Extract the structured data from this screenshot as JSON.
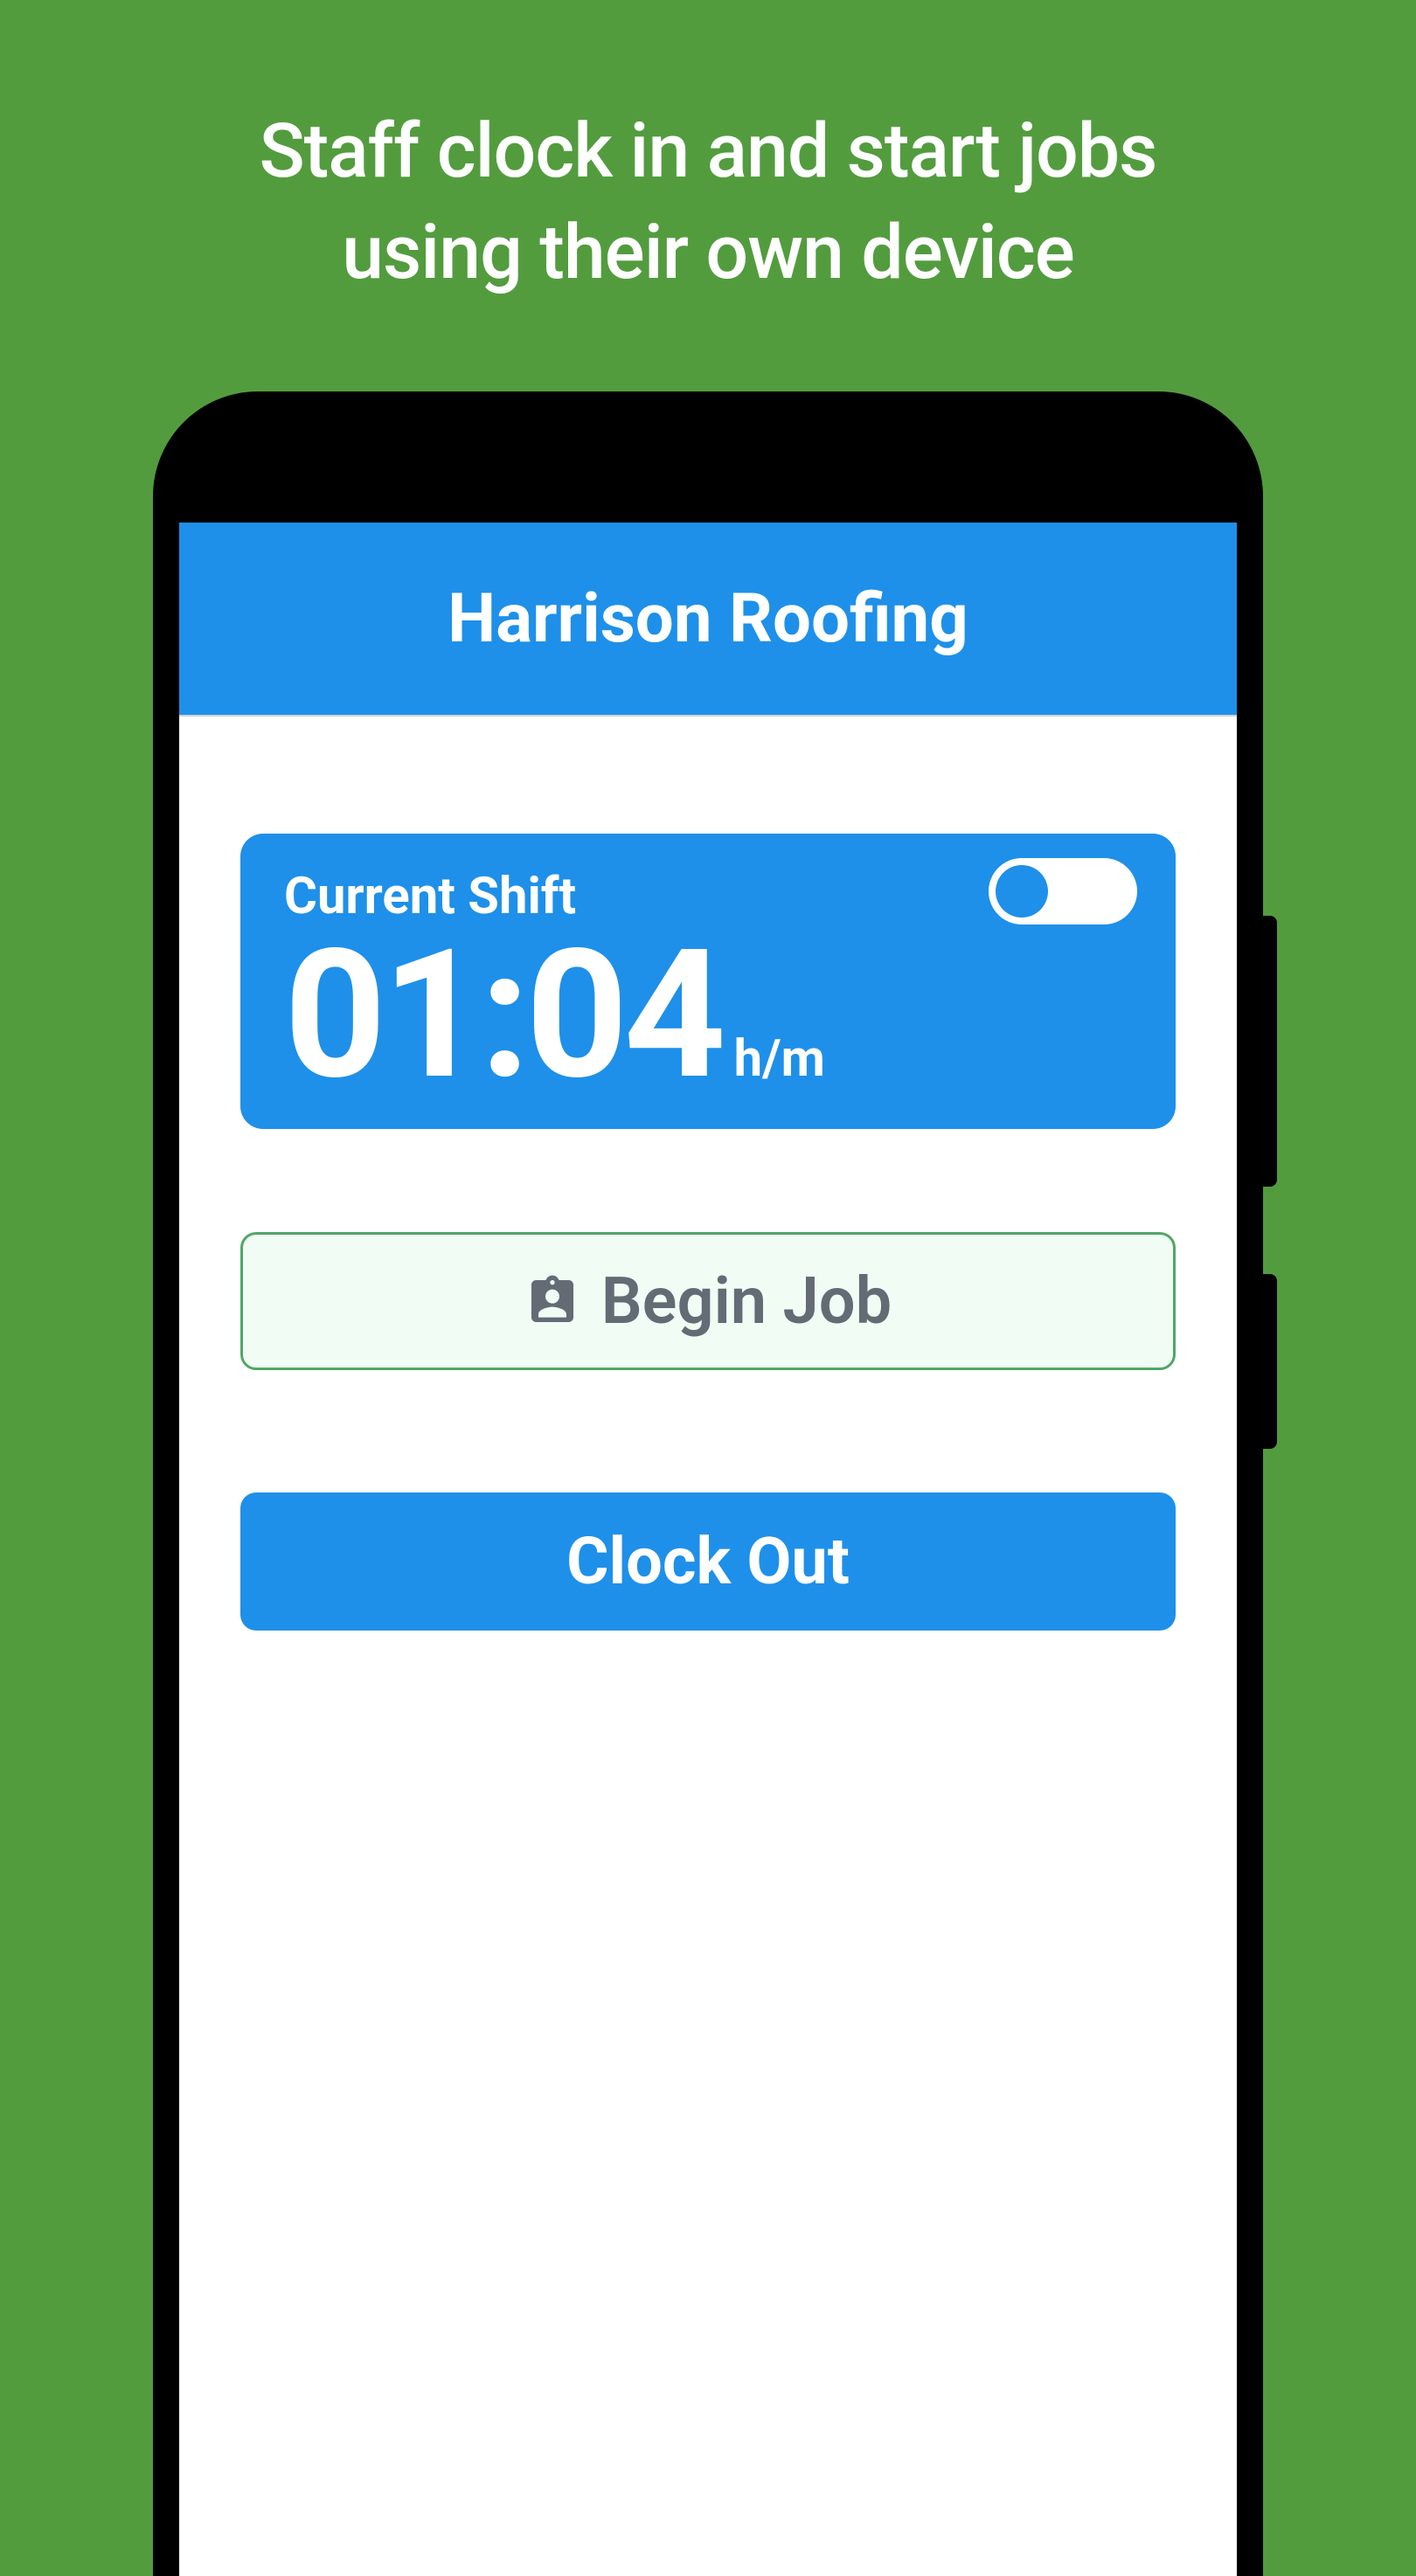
{
  "promo": {
    "headline_line1": "Staff clock in and start jobs",
    "headline_line2": "using their own device"
  },
  "app": {
    "title": "Harrison Roofing"
  },
  "shift": {
    "label": "Current Shift",
    "time": "01:04",
    "unit": "h/m",
    "toggle_on": false
  },
  "buttons": {
    "begin_job": "Begin Job",
    "clock_out": "Clock Out"
  }
}
